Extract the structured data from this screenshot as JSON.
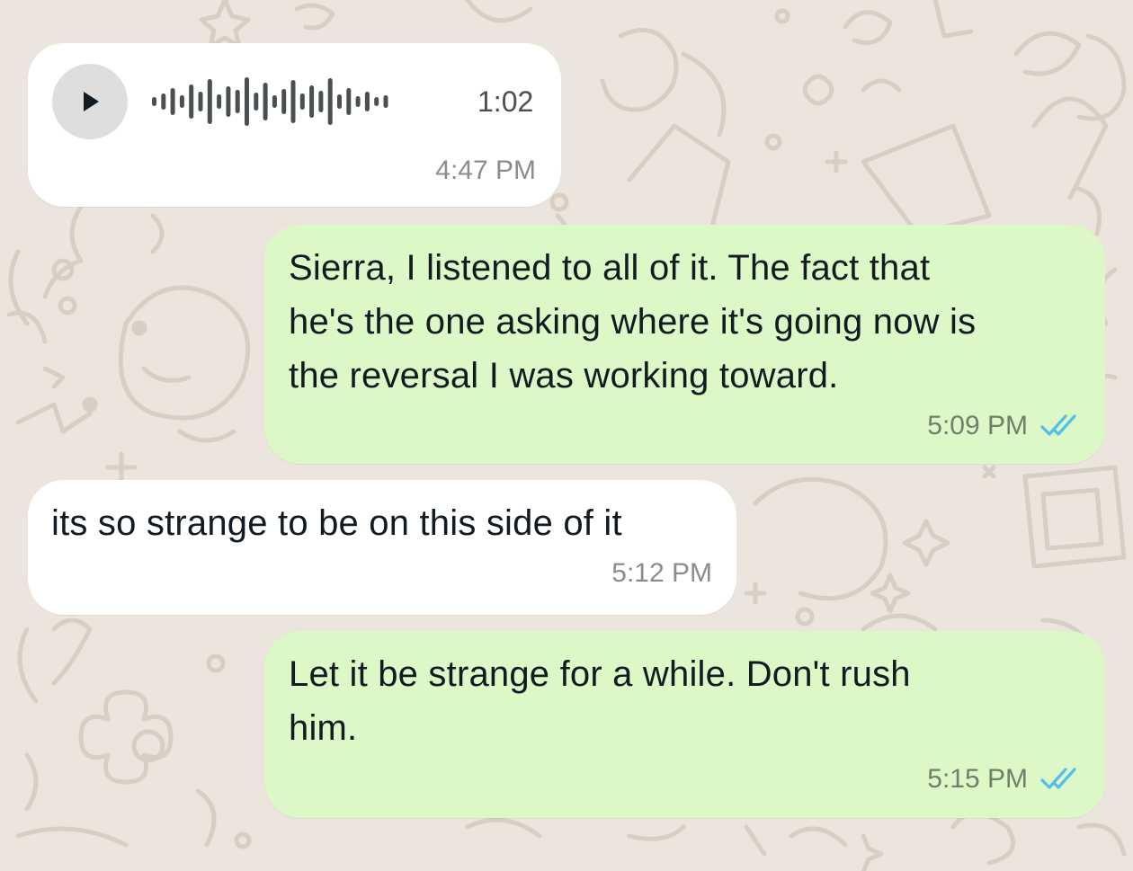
{
  "chat": {
    "messages": [
      {
        "type": "voice",
        "direction": "incoming",
        "duration": "1:02",
        "time": "4:47 PM"
      },
      {
        "type": "text",
        "direction": "outgoing",
        "lines": [
          "Sierra, I listened to all of it. The fact that",
          "he's the one asking where it's going now is",
          "the reversal I was working toward."
        ],
        "time": "5:09 PM",
        "status": "read"
      },
      {
        "type": "text",
        "direction": "incoming",
        "lines": [
          "its so strange to be on this side of it"
        ],
        "time": "5:12 PM"
      },
      {
        "type": "text",
        "direction": "outgoing",
        "lines": [
          "Let it be strange for a while. Don't rush",
          "him."
        ],
        "time": "5:15 PM",
        "status": "read"
      }
    ]
  },
  "icons": {
    "play": "play-icon",
    "waveform": "voice-waveform",
    "read_receipt": "double-check-icon"
  },
  "colors": {
    "background": "#ece5dd",
    "incoming_bubble": "#ffffff",
    "outgoing_bubble": "#dcf8c6",
    "read_ticks": "#53bdeb",
    "waveform": "#4a4f52"
  }
}
